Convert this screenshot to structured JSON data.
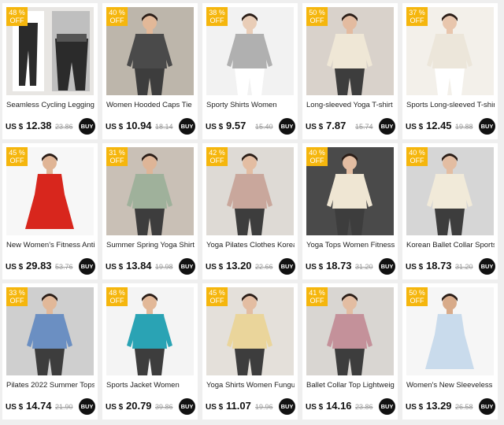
{
  "currency": "US $",
  "buy_label": "BUY",
  "off_label": "OFF",
  "products": [
    {
      "title": "Seamless Cycling Leggings",
      "price": "12.38",
      "original": "23.86",
      "discount": "48 %",
      "image": "leggings-photo",
      "bg": "#e8e6e3",
      "fig": "#2b2b2b",
      "skin": "#e7c2a6"
    },
    {
      "title": "Women Hooded Caps Tie",
      "price": "10.94",
      "original": "18.14",
      "discount": "40 %",
      "image": "hooded-top-photo",
      "bg": "#bdb6ab",
      "fig": "#4a4a4a",
      "skin": "#e2b898"
    },
    {
      "title": "Sporty Shirts Women",
      "price": "9.57",
      "original": "15.40",
      "discount": "38 %",
      "image": "grey-shirt-photo",
      "bg": "#f2f2f2",
      "fig": "#b0b0b0",
      "skin": "#e9cdb7"
    },
    {
      "title": "Long-sleeved Yoga T-shirt",
      "price": "7.87",
      "original": "15.74",
      "discount": "50 %",
      "image": "yoga-tshirt-photo",
      "bg": "#d9d2cb",
      "fig": "#efe7d6",
      "skin": "#e3bba0"
    },
    {
      "title": "Sports Long-sleeved T-shirt",
      "price": "12.45",
      "original": "19.88",
      "discount": "37 %",
      "image": "white-tshirt-photo",
      "bg": "#f3f0ea",
      "fig": "#ece6da",
      "skin": "#e8c6ad"
    },
    {
      "title": "New Women's Fitness Anti",
      "price": "29.83",
      "original": "53.76",
      "discount": "45 %",
      "image": "red-dress-photo",
      "bg": "#f7f7f7",
      "fig": "#d8261d",
      "skin": "#e0b596"
    },
    {
      "title": "Summer Spring Yoga Shirts",
      "price": "13.84",
      "original": "19.98",
      "discount": "31 %",
      "image": "sage-shirt-photo",
      "bg": "#c9c0b6",
      "fig": "#9fb19b",
      "skin": "#deb597"
    },
    {
      "title": "Yoga Pilates Clothes Korean",
      "price": "13.20",
      "original": "22.66",
      "discount": "42 %",
      "image": "pink-tee-photo",
      "bg": "#dedad5",
      "fig": "#c9a79c",
      "skin": "#e3bda2"
    },
    {
      "title": "Yoga Tops Women Fitness -",
      "price": "18.73",
      "original": "31.20",
      "discount": "40 %",
      "image": "cream-top-photo",
      "bg": "#4a4a4a",
      "fig": "#efe6d3",
      "skin": "#e3bda2"
    },
    {
      "title": "Korean Ballet Collar Sports",
      "price": "18.73",
      "original": "31.20",
      "discount": "40 %",
      "image": "ballet-top-photo",
      "bg": "#d6d6d6",
      "fig": "#f1ead9",
      "skin": "#e3bda2"
    },
    {
      "title": "Pilates 2022 Summer Tops",
      "price": "14.74",
      "original": "21.90",
      "discount": "33 %",
      "image": "blue-top-photo",
      "bg": "#cfcfcf",
      "fig": "#6b8fc2",
      "skin": "#e1b899"
    },
    {
      "title": "Sports Jacket Women",
      "price": "20.79",
      "original": "39.86",
      "discount": "48 %",
      "image": "teal-jacket-photo",
      "bg": "#f4f4f4",
      "fig": "#2aa3b4",
      "skin": "#e2b898"
    },
    {
      "title": "Yoga Shirts Women Fungus",
      "price": "11.07",
      "original": "19.96",
      "discount": "45 %",
      "image": "yellow-top-photo",
      "bg": "#e4e0da",
      "fig": "#ead59b",
      "skin": "#e3bda2"
    },
    {
      "title": "Ballet Collar Top Lightweight",
      "price": "14.16",
      "original": "23.86",
      "discount": "41 %",
      "image": "mauve-top-photo",
      "bg": "#d9d6d2",
      "fig": "#c4919a",
      "skin": "#e3bda2"
    },
    {
      "title": "Women's New Sleeveless",
      "price": "13.29",
      "original": "26.58",
      "discount": "50 %",
      "image": "tennis-dress-photo",
      "bg": "#f6f6f6",
      "fig": "#c9dbec",
      "skin": "#d8ab8a"
    }
  ]
}
